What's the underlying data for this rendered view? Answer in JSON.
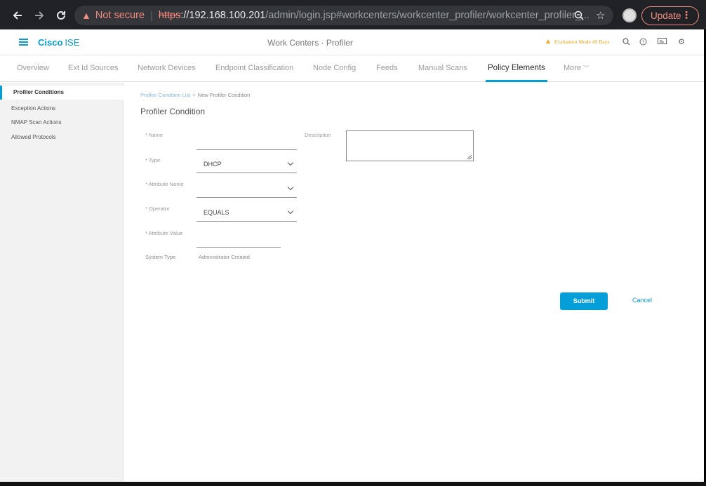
{
  "browser": {
    "warning_text": "Not secure",
    "url_protocol": "https",
    "url_host": "://192.168.100.201",
    "url_path": "/admin/login.jsp#workcenters/workcenter_profiler/workcenter_profiler_...",
    "update_label": "Update"
  },
  "header": {
    "brand": "Cisco",
    "product": "ISE",
    "title": "Work Centers · Profiler",
    "evaluation": "Evaluation Mode 49 Days"
  },
  "tabs": [
    {
      "label": "Overview"
    },
    {
      "label": "Ext Id Sources"
    },
    {
      "label": "Network Devices"
    },
    {
      "label": "Endpoint Classification"
    },
    {
      "label": "Node Config"
    },
    {
      "label": "Feeds"
    },
    {
      "label": "Manual Scans"
    },
    {
      "label": "Policy Elements",
      "active": true
    },
    {
      "label": "More"
    }
  ],
  "sidebar": {
    "items": [
      {
        "label": "Profiler Conditions",
        "active": true
      },
      {
        "label": "Exception Actions"
      },
      {
        "label": "NMAP Scan Actions"
      },
      {
        "label": "Allowed Protocols"
      }
    ]
  },
  "breadcrumb": {
    "parent": "Profiler Condition List",
    "current": "New Profiler Condition"
  },
  "page_title": "Profiler Condition",
  "form": {
    "name_label": "* Name",
    "name_value": "",
    "description_label": "Description",
    "type_label": "* Type",
    "type_value": "DHCP",
    "attribute_name_label": "* Attribute Name",
    "attribute_name_value": "",
    "operator_label": "* Operator",
    "operator_value": "EQUALS",
    "attribute_value_label": "* Attribute Value",
    "attribute_value_value": "",
    "system_type_label": "System Type",
    "system_type_value": "Administrator Created"
  },
  "actions": {
    "submit_label": "Submit",
    "cancel_label": "Cancel"
  },
  "colors": {
    "accent": "#049fd9",
    "warning": "#f28b82",
    "eval": "#e8a317"
  }
}
